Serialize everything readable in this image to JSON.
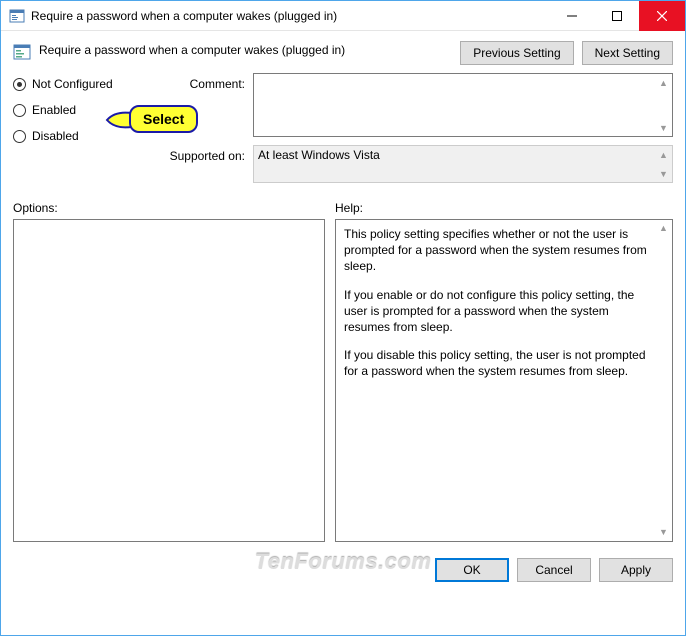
{
  "window": {
    "title": "Require a password when a computer wakes (plugged in)"
  },
  "header": {
    "policy_name": "Require a password when a computer wakes (plugged in)",
    "prev_btn": "Previous Setting",
    "next_btn": "Next Setting"
  },
  "radios": {
    "not_configured": "Not Configured",
    "enabled": "Enabled",
    "disabled": "Disabled",
    "selected": "not_configured"
  },
  "fields": {
    "comment_label": "Comment:",
    "comment_value": "",
    "supported_label": "Supported on:",
    "supported_value": "At least Windows Vista"
  },
  "lower": {
    "options_label": "Options:",
    "help_label": "Help:",
    "help_p1": "This policy setting specifies whether or not the user is prompted for a password when the system resumes from sleep.",
    "help_p2": "If you enable or do not configure this policy setting, the user is prompted for a password when the system resumes from sleep.",
    "help_p3": "If you disable this policy setting, the user is not prompted for a password when the system resumes from sleep."
  },
  "footer": {
    "ok": "OK",
    "cancel": "Cancel",
    "apply": "Apply"
  },
  "callout": {
    "text": "Select"
  },
  "watermark": "TenForums.com"
}
